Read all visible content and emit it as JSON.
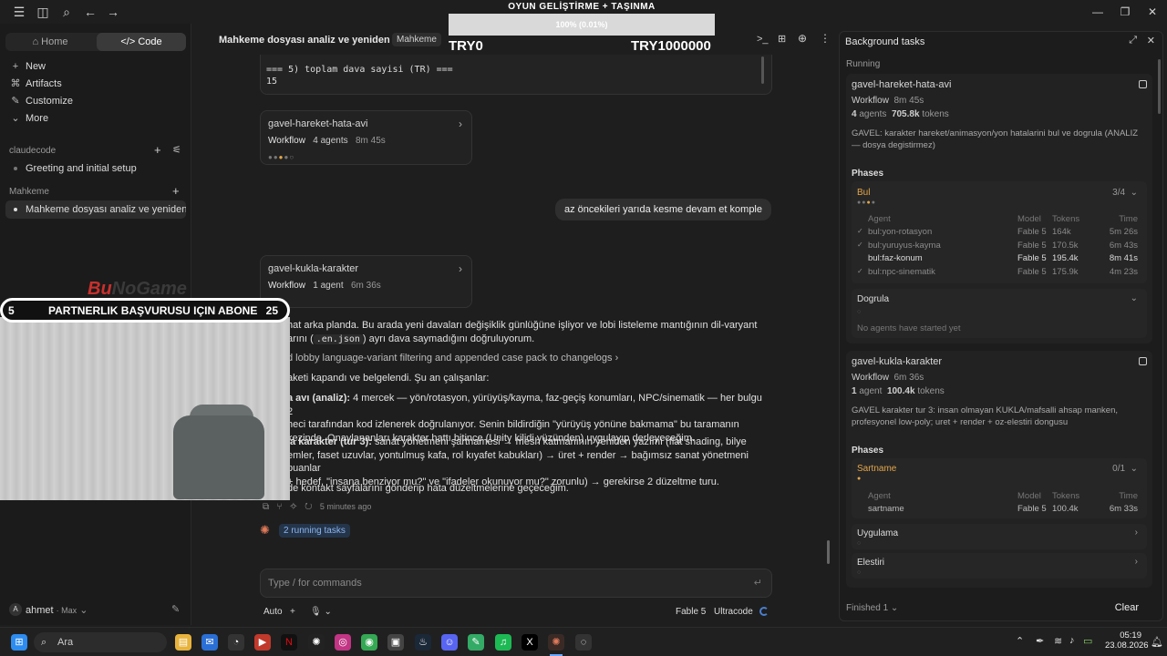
{
  "overlay": {
    "title": "OYUN GELİŞTİRME + TAŞINMA",
    "progress_text": "100% (0.01%)",
    "progress_value": 0.0001,
    "left_amount": "TRY0",
    "right_amount": "TRY1000000",
    "brand_a": "Bu",
    "brand_b": "NoGame",
    "banner_left": "5",
    "banner_text": "PARTNERLIK BAŞVURUSU IÇIN ABONE",
    "banner_right": "25"
  },
  "sidebar": {
    "tab_home": "Home",
    "tab_code": "Code",
    "nav": [
      {
        "icon": "plus-icon",
        "glyph": "+",
        "label": "New"
      },
      {
        "icon": "artifacts-icon",
        "glyph": "⌘",
        "label": "Artifacts"
      },
      {
        "icon": "customize-icon",
        "glyph": "✎",
        "label": "Customize"
      },
      {
        "icon": "chevron-down-icon",
        "glyph": "⌄",
        "label": "More"
      }
    ],
    "section1": "claudecode",
    "session1": "Greeting and initial setup",
    "section2": "Mahkeme",
    "session2": "Mahkeme dosyası analiz ve yeniden yazım",
    "user_initial": "A",
    "user_name": "ahmet",
    "user_plan": "· Max"
  },
  "main": {
    "title": "Mahkeme dosyası analiz ve yeniden yazım",
    "tag": "Mahkeme",
    "code_line1": "=== 5) toplam dava sayisi (TR) ===",
    "code_line2": "15",
    "wf1": {
      "title": "gavel-hareket-hata-avi",
      "kind": "Workflow",
      "agents": "4 agents",
      "time": "8m 45s"
    },
    "user_msg": "az öncekileri yarıda kesme devam et komple",
    "wf2": {
      "title": "gavel-kukla-karakter",
      "kind": "Workflow",
      "agents": "1 agent",
      "time": "6m 36s"
    },
    "msg1a": "hat arka planda. Bu arada yeni davaları değişiklik günlüğüne işliyor ve lobi listeleme mantığının dil-varyant",
    "msg1b_pre": "arını (",
    "msg1b_code": ".en.json",
    "msg1b_post": ") ayrı dava saymadığını doğruluyorum.",
    "tool_line": "d lobby language-variant filtering and appended case pack to changelogs",
    "msg2": "aketi kapandı ve belgelendi. Şu an çalışanlar:",
    "msg3_bold": "a avı (analiz):",
    "msg3": " 4 mercek — yön/rotasyon, yürüyüş/kayma, faz-geçiş konumları, NPC/sinematik — her bulgu 2",
    "msg3b": "heci tarafından kod izlenerek doğrulanıyor. Senin bildirdiğin \"yürüyüş yönüne bakmama\" bu taramanın",
    "msg3c": "kezinde. Onaylananları karakter hattı bitince (Unity kilidi yüzünden) uygulayıp derleyeceğim.",
    "msg4_bold": "la karakter (tur 3):",
    "msg4": " sanat yönetmeni şartnamesi → mesh katmanının yeniden yazımı (flat shading, bilye",
    "msg4b": "emler, faset uzuvlar, yontulmuş kafa, rol kıyafet kabukları) → üret + render → bağımsız sanat yönetmeni puanlar",
    "msg4c": "+ hedef, \"insana benziyor mu?\" ve \"ifadeler okunuyor mu?\" zorunlu) → gerekirse 2 düzeltme turu.",
    "msg5": "de kontakt sayfalarını gönderip hata düzeltmelerine geçeceğim.",
    "timestamp": "5 minutes ago",
    "running": "2 running tasks",
    "input_placeholder": "Type / for commands",
    "mode": "Auto",
    "model": "Fable 5",
    "effort": "Ultracode"
  },
  "panel": {
    "title": "Background tasks",
    "running_label": "Running",
    "task1": {
      "title": "gavel-hareket-hata-avi",
      "kind": "Workflow",
      "time": "8m 45s",
      "agents": "4",
      "agents_word": "agents",
      "tokens": "705.8k",
      "tokens_word": "tokens",
      "desc": "GAVEL: karakter hareket/animasyon/yon hatalarini bul ve dogrula (ANALIZ — dosya degistirmez)",
      "phases_label": "Phases",
      "phase1": {
        "name": "Bul",
        "count": "3/4"
      },
      "cols": [
        "Agent",
        "Model",
        "Tokens",
        "Time"
      ],
      "rows": [
        {
          "check": "✓",
          "agent": "bul:yon-rotasyon",
          "model": "Fable 5",
          "tokens": "164k",
          "time": "5m 26s",
          "active": false
        },
        {
          "check": "✓",
          "agent": "bul:yuruyus-kayma",
          "model": "Fable 5",
          "tokens": "170.5k",
          "time": "6m 43s",
          "active": false
        },
        {
          "check": "",
          "agent": "bul:faz-konum",
          "model": "Fable 5",
          "tokens": "195.4k",
          "time": "8m 41s",
          "active": true
        },
        {
          "check": "✓",
          "agent": "bul:npc-sinematik",
          "model": "Fable 5",
          "tokens": "175.9k",
          "time": "4m 23s",
          "active": false
        }
      ],
      "phase2": {
        "name": "Dogrula"
      },
      "phase2_empty": "No agents have started yet"
    },
    "task2": {
      "title": "gavel-kukla-karakter",
      "kind": "Workflow",
      "time": "6m 36s",
      "agents": "1",
      "agents_word": "agent",
      "tokens": "100.4k",
      "tokens_word": "tokens",
      "desc": "GAVEL karakter tur 3: insan olmayan KUKLA/mafsalli ahsap manken, profesyonel low-poly; uret + render + oz-elestiri dongusu",
      "phases_label": "Phases",
      "phase1": {
        "name": "Sartname",
        "count": "0/1"
      },
      "cols": [
        "Agent",
        "Model",
        "Tokens",
        "Time"
      ],
      "row": {
        "agent": "sartname",
        "model": "Fable 5",
        "tokens": "100.4k",
        "time": "6m 33s"
      },
      "phase2": {
        "name": "Uygulama"
      },
      "phase3": {
        "name": "Elestiri"
      }
    },
    "finished": "Finished 1",
    "clear": "Clear"
  },
  "taskbar": {
    "search": "Ara",
    "time": "05:19",
    "date": "23.08.2026"
  },
  "colors": {
    "accent": "#e3a64a",
    "link": "#8cb4ee",
    "claude": "#e07a5a"
  }
}
